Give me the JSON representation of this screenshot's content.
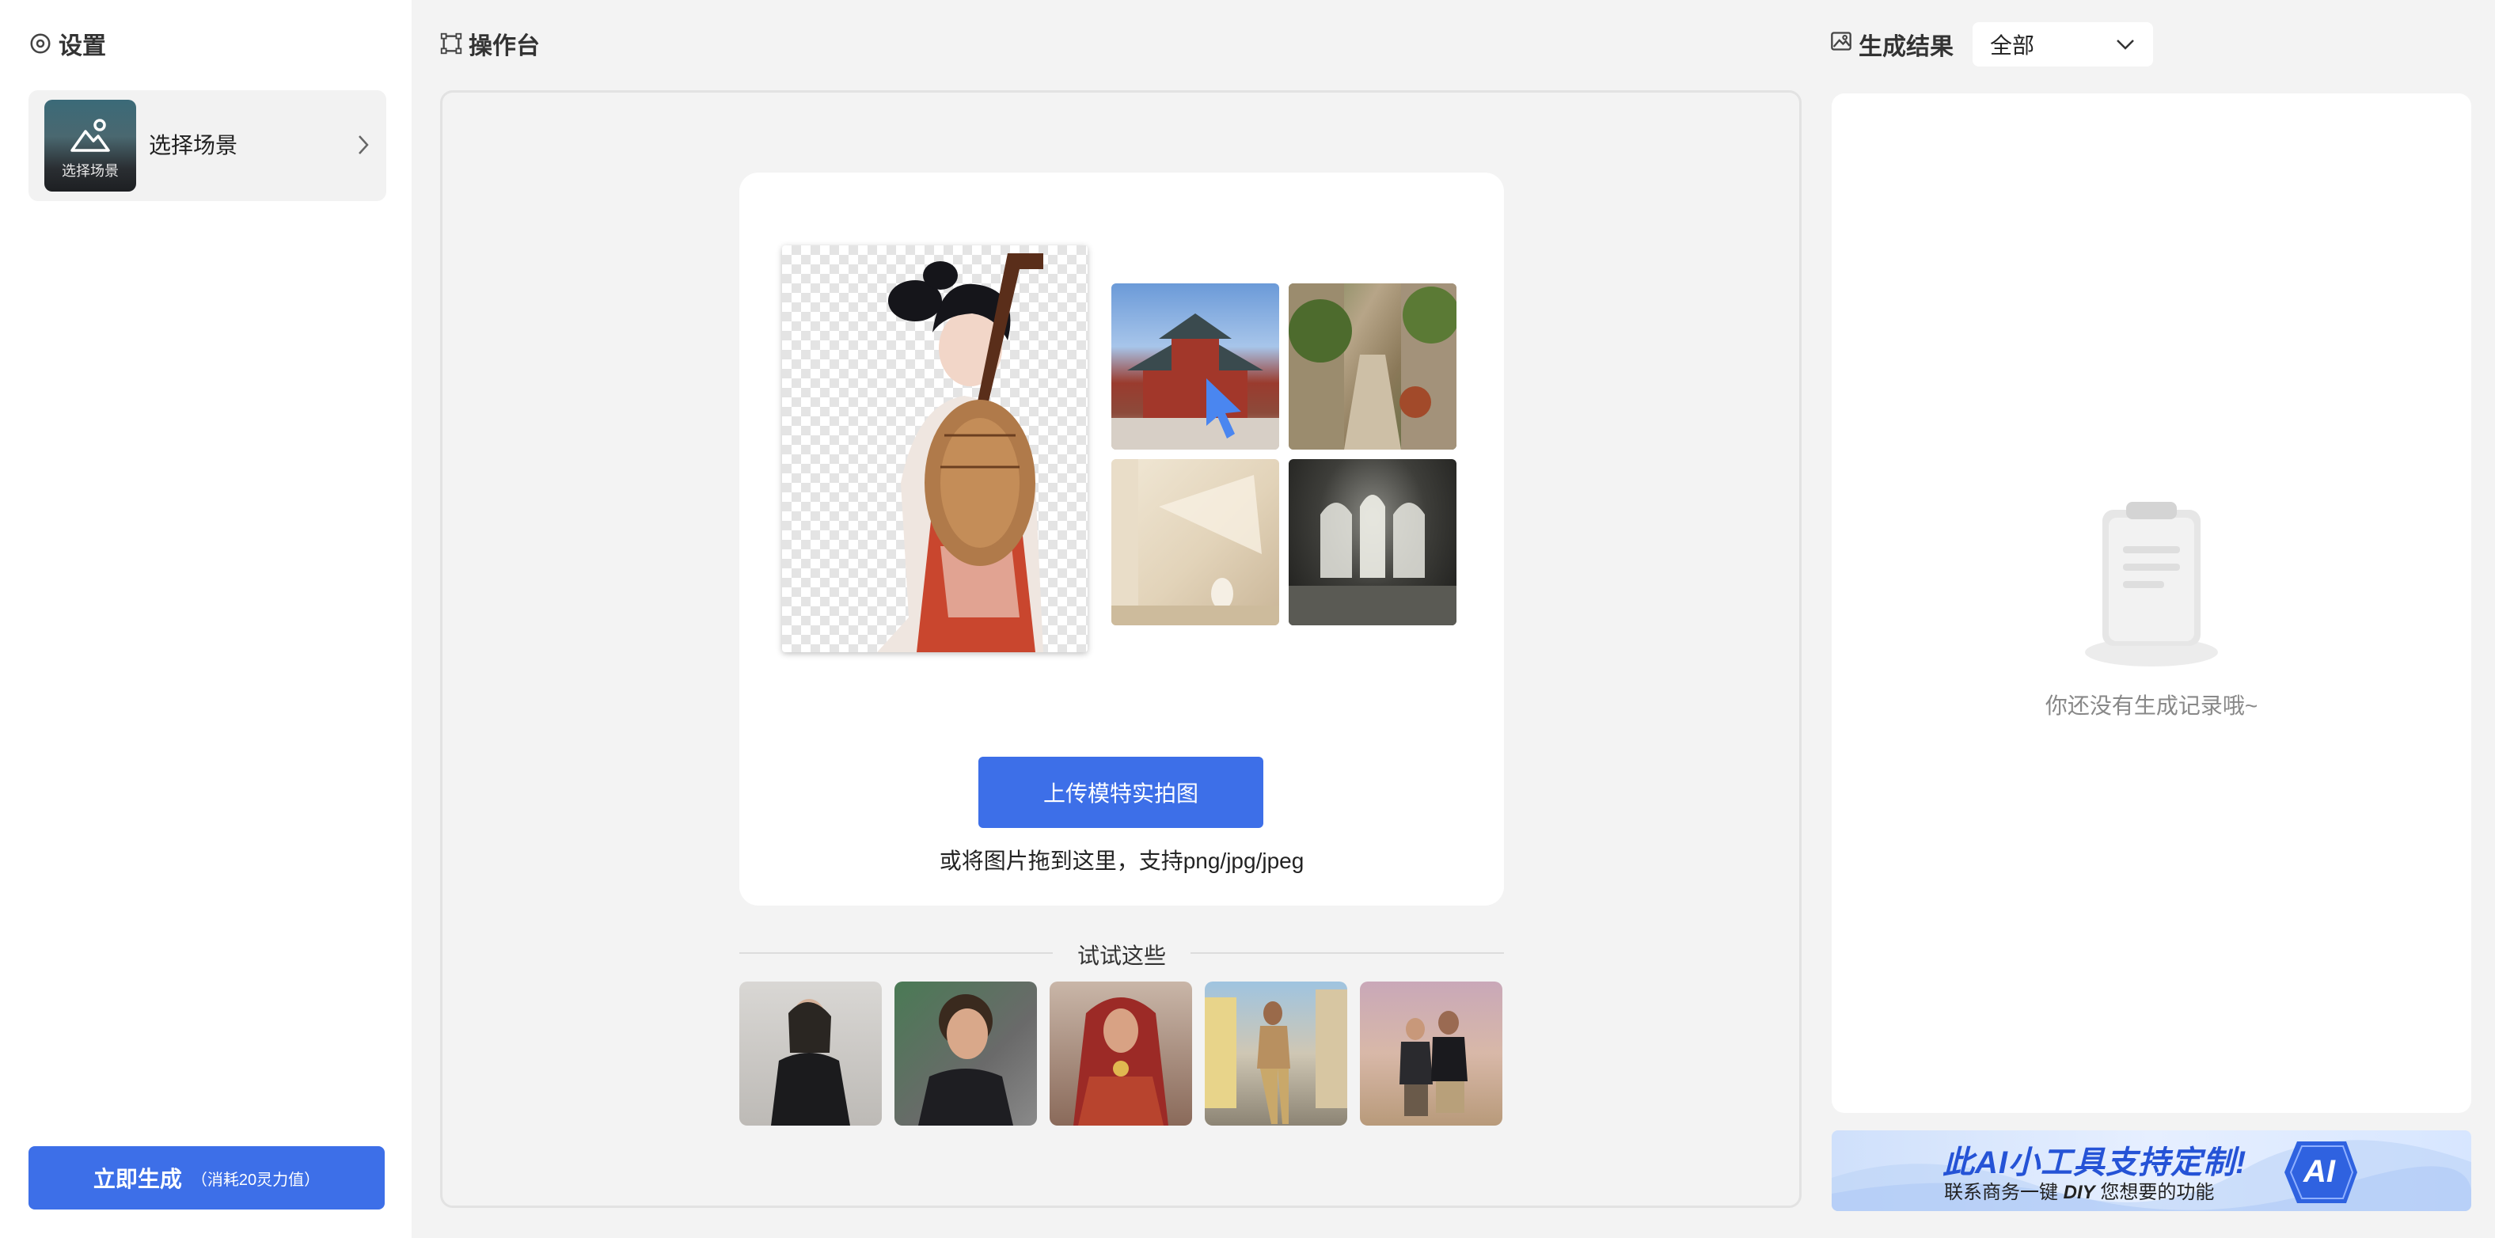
{
  "settings": {
    "title": "设置",
    "scene_thumb_caption": "选择场景",
    "scene_select_label": "选择场景"
  },
  "generate": {
    "label": "立即生成",
    "cost": "（消耗20灵力值）"
  },
  "workspace": {
    "title": "操作台",
    "upload_button": "上传模特实拍图",
    "upload_hint": "或将图片拖到这里，支持png/jpg/jpeg",
    "try_title": "试试这些",
    "samples": [
      {
        "name": "sample-woman-black-turtleneck"
      },
      {
        "name": "sample-woman-curly-hair"
      },
      {
        "name": "sample-bride-red-dress"
      },
      {
        "name": "sample-man-street"
      },
      {
        "name": "sample-couple-desert"
      }
    ]
  },
  "results": {
    "title": "生成结果",
    "filter_value": "全部",
    "empty_text": "你还没有生成记录哦~"
  },
  "banner": {
    "title": "此AI小工具支持定制!",
    "sub_before": "联系商务一键 ",
    "sub_bold": "DIY",
    "sub_after": " 您想要的功能",
    "badge": "AI"
  },
  "colors": {
    "accent": "#3d6fe8",
    "banner_text": "#2553d6"
  }
}
